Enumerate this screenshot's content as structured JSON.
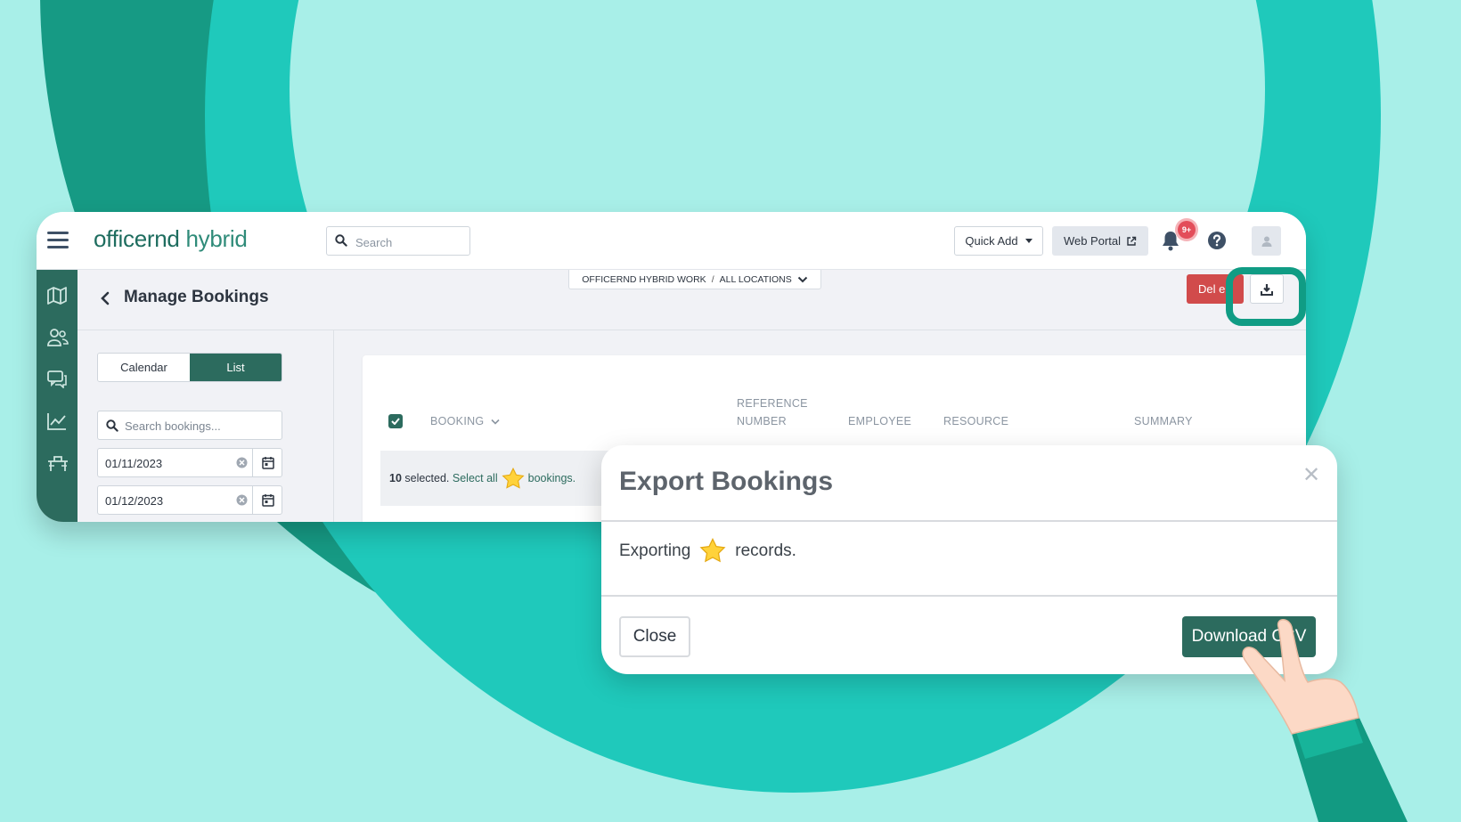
{
  "app": {
    "logo": {
      "brand": "officernd",
      "product": "hybrid"
    },
    "search": {
      "placeholder": "Search"
    },
    "quick_add_label": "Quick Add",
    "web_portal_label": "Web Portal",
    "notification_badge": "9+",
    "breadcrumb": {
      "workspace": "OFFICERND HYBRID WORK",
      "separator": "/",
      "location": "ALL LOCATIONS"
    },
    "page_title": "Manage Bookings",
    "delete_label": "Del e",
    "sidebar_icons": [
      "map-icon",
      "people-icon",
      "chat-icon",
      "chart-icon",
      "desk-icon"
    ]
  },
  "filters": {
    "view_tabs": [
      "Calendar",
      "List"
    ],
    "active_view": "List",
    "search_placeholder": "Search bookings...",
    "start_date": "01/11/2023",
    "end_date": "01/12/2023"
  },
  "table": {
    "columns": {
      "booking": "BOOKING",
      "reference_line1": "REFERENCE",
      "reference_line2": "NUMBER",
      "employee": "EMPLOYEE",
      "resource": "RESOURCE",
      "summary": "SUMMARY"
    },
    "selection": {
      "count": "10",
      "text": " selected. ",
      "select_all": "Select all",
      "after": "bookings."
    }
  },
  "modal": {
    "title": "Export Bookings",
    "body_before": "Exporting",
    "body_after": "records.",
    "close_label": "Close",
    "download_label": "Download CSV"
  },
  "colors": {
    "brand_dark": "#2c6b5e",
    "delete_red": "#d14b4b",
    "highlight_ring": "#109c84",
    "background": "#a8efe8"
  }
}
